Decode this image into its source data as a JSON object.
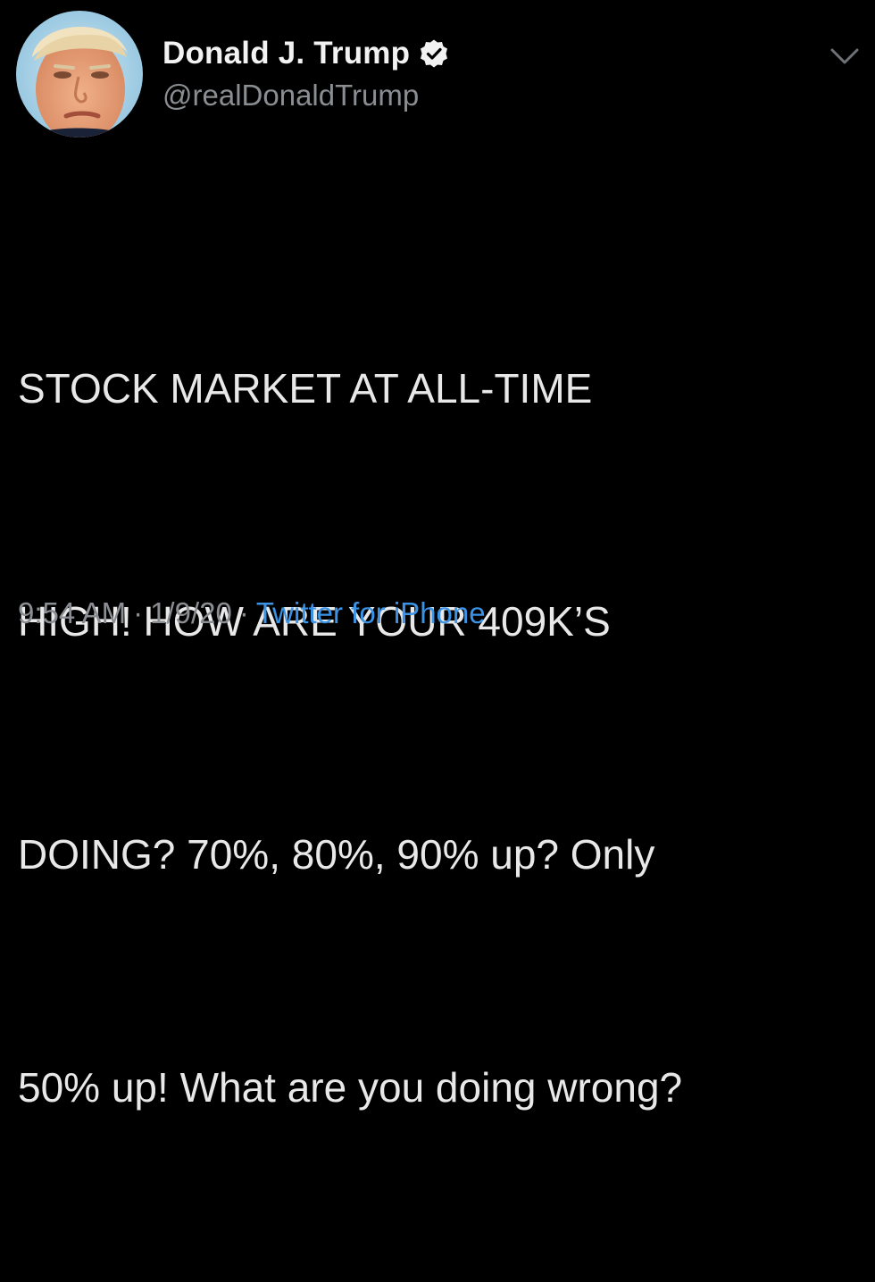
{
  "author": {
    "display_name": "Donald J. Trump",
    "handle": "@realDonaldTrump",
    "verified": true,
    "verified_icon": "verified-badge-icon",
    "avatar_icon": "profile-avatar"
  },
  "tweet": {
    "lines": [
      "STOCK MARKET AT ALL-TIME",
      "HIGH! HOW ARE YOUR 409K’S",
      "DOING? 70%, 80%, 90% up? Only",
      "50% up! What are you doing wrong?"
    ]
  },
  "meta": {
    "time": "9:54 AM",
    "separator": "·",
    "date": "1/9/20",
    "source": "Twitter for iPhone"
  },
  "menu": {
    "icon": "chevron-down-icon"
  },
  "colors": {
    "background": "#000000",
    "text": "#e8e8e8",
    "muted": "#8a8d91",
    "link": "#3b93e6"
  }
}
